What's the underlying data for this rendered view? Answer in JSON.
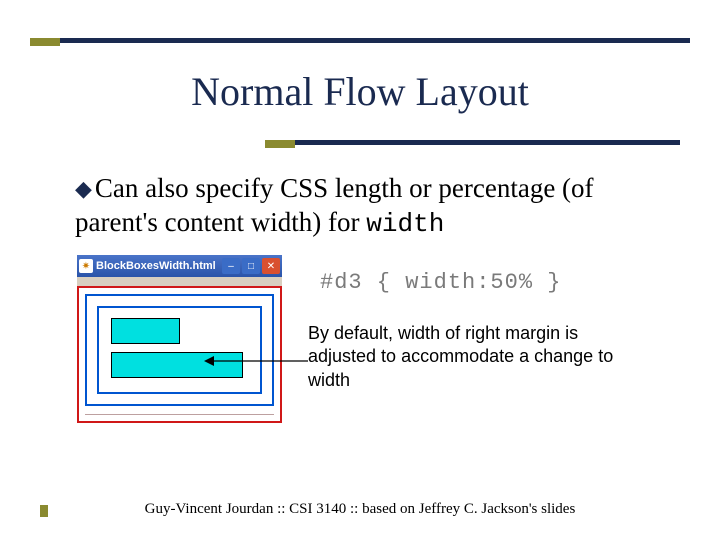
{
  "title": "Normal Flow Layout",
  "bullet": {
    "text_before": "Can also specify CSS length or percentage (of parent's content width) for ",
    "code": "width"
  },
  "browser": {
    "window_title": "BlockBoxesWidth.html - M…"
  },
  "css_snippet": "#d3 { width:50% }",
  "explain": "By default, width of right margin is adjusted to accommodate a change to width",
  "footer": "Guy-Vincent Jourdan :: CSI 3140 :: based on Jeffrey C. Jackson's slides"
}
